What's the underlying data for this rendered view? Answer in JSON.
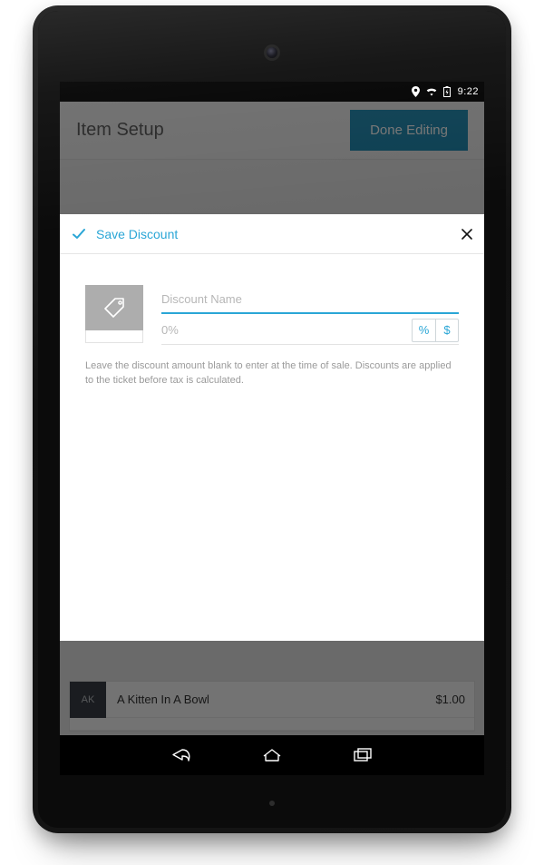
{
  "statusbar": {
    "time": "9:22"
  },
  "app": {
    "header_title": "Item Setup",
    "done_label": "Done Editing",
    "list": {
      "row1": {
        "swatch": "AK",
        "name": "A Kitten In A Bowl",
        "price": "$1.00"
      }
    }
  },
  "modal": {
    "title": "Save Discount",
    "name_placeholder": "Discount Name",
    "name_value": "",
    "amount_placeholder": "0%",
    "amount_value": "",
    "toggle_percent": "%",
    "toggle_dollar": "$",
    "helper": "Leave the discount amount blank to enter at the time of sale. Discounts are applied to the ticket before tax is calculated."
  }
}
